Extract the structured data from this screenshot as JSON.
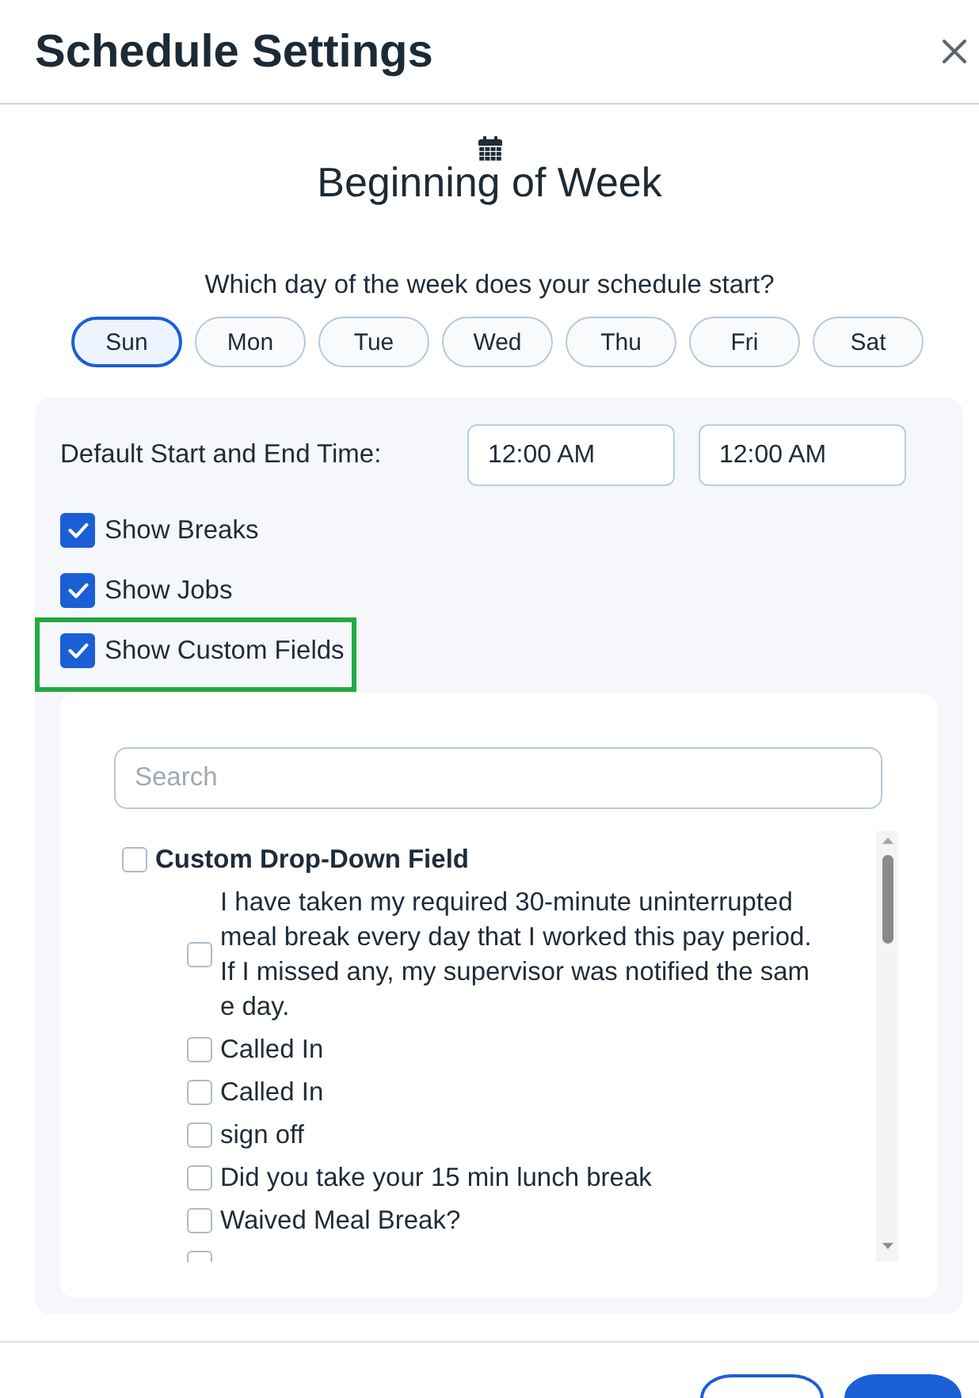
{
  "dialog": {
    "title": "Schedule Settings"
  },
  "week_start": {
    "title": "Beginning of Week",
    "question": "Which day of the week does your schedule start?",
    "days": [
      {
        "label": "Sun",
        "selected": true
      },
      {
        "label": "Mon",
        "selected": false
      },
      {
        "label": "Tue",
        "selected": false
      },
      {
        "label": "Wed",
        "selected": false
      },
      {
        "label": "Thu",
        "selected": false
      },
      {
        "label": "Fri",
        "selected": false
      },
      {
        "label": "Sat",
        "selected": false
      }
    ]
  },
  "settings": {
    "time_label": "Default Start and End Time:",
    "times": [
      {
        "value": "12:00 AM"
      },
      {
        "value": "12:00 AM"
      }
    ],
    "options": [
      {
        "label": "Show Breaks",
        "checked": true,
        "highlighted": false
      },
      {
        "label": "Show Jobs",
        "checked": true,
        "highlighted": false
      },
      {
        "label": "Show Custom Fields",
        "checked": true,
        "highlighted": true
      }
    ]
  },
  "custom_fields": {
    "search": {
      "placeholder": "Search"
    },
    "items": [
      {
        "label": "Custom Drop-Down Field",
        "checked": false,
        "children": [
          {
            "label": "I have taken my required 30-minute uninterrupted meal break every day that I worked this pay period. If I missed any, my supervisor was notified the same day.",
            "checked": false
          },
          {
            "label": "Called In",
            "checked": false
          },
          {
            "label": "Called In",
            "checked": false
          },
          {
            "label": "sign off",
            "checked": false
          },
          {
            "label": "Did you take your 15 min lunch break",
            "checked": false
          },
          {
            "label": "Waived Meal Break?",
            "checked": false
          },
          {
            "checked": false
          }
        ]
      }
    ]
  },
  "footer": {
    "buttons": [
      {
        "kind": "outline"
      },
      {
        "kind": "filled"
      }
    ]
  }
}
